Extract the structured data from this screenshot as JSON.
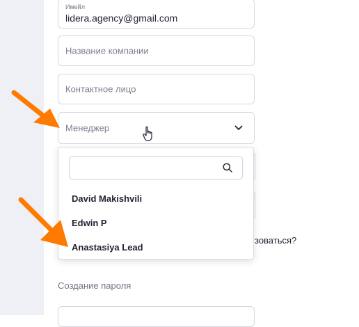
{
  "form": {
    "email": {
      "label": "Имейл",
      "value": "lidera.agency@gmail.com"
    },
    "company": {
      "placeholder": "Название компании"
    },
    "contact": {
      "placeholder": "Контактное лицо"
    },
    "manager": {
      "placeholder": "Менеджер"
    }
  },
  "dropdown": {
    "search_value": "",
    "options": [
      "David Makishvili",
      "Edwin P",
      "Anastasiya Lead"
    ]
  },
  "partial_question": "зоваться?",
  "password_section": {
    "label": "Создание пароля"
  },
  "colors": {
    "arrow": "#ff7a00",
    "border": "#d4d7de",
    "side_bg": "#eef0f5"
  }
}
